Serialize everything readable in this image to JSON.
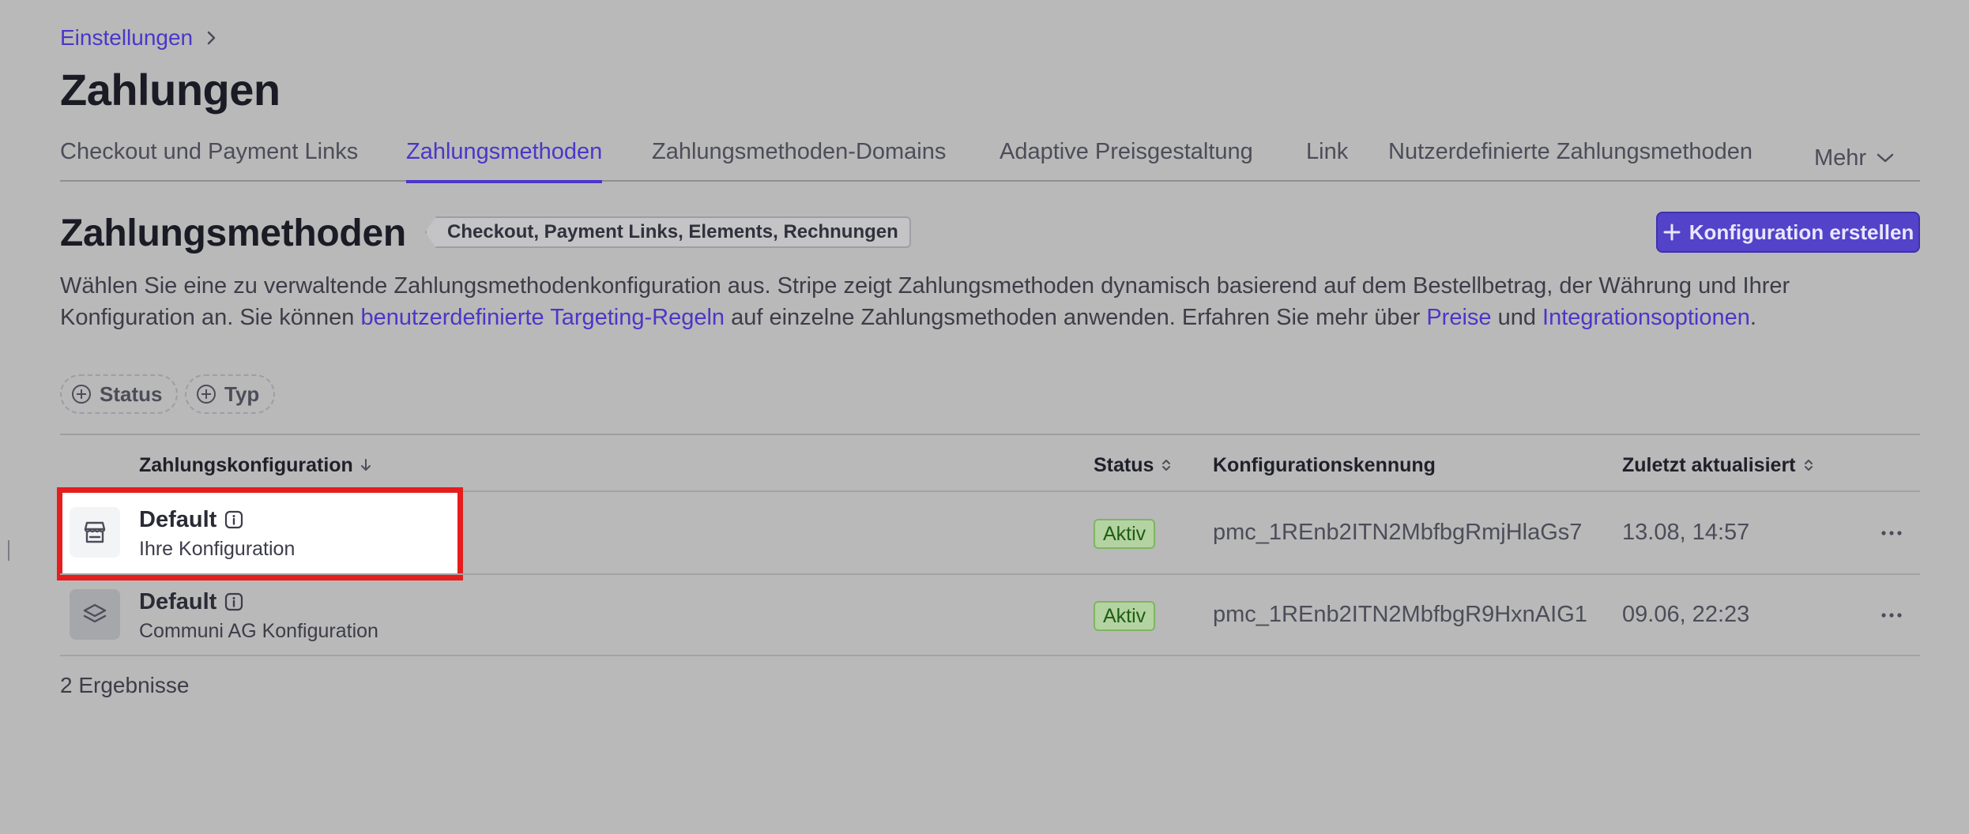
{
  "breadcrumb": {
    "parent": "Einstellungen"
  },
  "page_title": "Zahlungen",
  "tabs": [
    {
      "label": "Checkout und Payment Links"
    },
    {
      "label": "Zahlungsmethoden"
    },
    {
      "label": "Zahlungsmethoden-Domains"
    },
    {
      "label": "Adaptive Preisgestaltung"
    },
    {
      "label": "Link"
    },
    {
      "label": "Nutzerdefinierte Zahlungsmethoden"
    },
    {
      "label": "Mehr"
    }
  ],
  "active_tab": "Zahlungsmethoden",
  "section": {
    "title": "Zahlungsmethoden",
    "scope_badge": "Checkout, Payment Links, Elements, Rechnungen",
    "create_button": "Konfiguration erstellen",
    "description": {
      "part1": "Wählen Sie eine zu verwaltende Zahlungsmethodenkonfiguration aus. Stripe zeigt Zahlungsmethoden dynamisch basierend auf dem Bestellbetrag, der Währung und Ihrer Konfiguration an. Sie können ",
      "link1": "benutzerdefinierte Targeting-Regeln",
      "part2": " auf einzelne Zahlungsmethoden anwenden. Erfahren Sie mehr über ",
      "link2": "Preise",
      "part3": " und ",
      "link3": "Integrationsoptionen",
      "part4": "."
    }
  },
  "filters": [
    {
      "label": "Status"
    },
    {
      "label": "Typ"
    }
  ],
  "table": {
    "columns": {
      "config": "Zahlungskonfiguration",
      "status": "Status",
      "id": "Konfigurationskennung",
      "updated": "Zuletzt aktualisiert"
    },
    "rows": [
      {
        "icon": "storefront-icon",
        "name": "Default",
        "subtitle": "Ihre Konfiguration",
        "status": "Aktiv",
        "id": "pmc_1REnb2ITN2MbfbgRmjHlaGs7",
        "updated": "13.08, 14:57"
      },
      {
        "icon": "layers-icon",
        "name": "Default",
        "subtitle": "Communi AG Konfiguration",
        "status": "Aktiv",
        "id": "pmc_1REnb2ITN2MbfbgR9HxnAIG1",
        "updated": "09.06, 22:23"
      }
    ],
    "results_count": "2 Ergebnisse"
  },
  "colors": {
    "accent": "#4b36c9",
    "overlay_bg": "#b9b9b9",
    "highlight": "#e51d1d",
    "badge_green": "#b4d3a2"
  }
}
